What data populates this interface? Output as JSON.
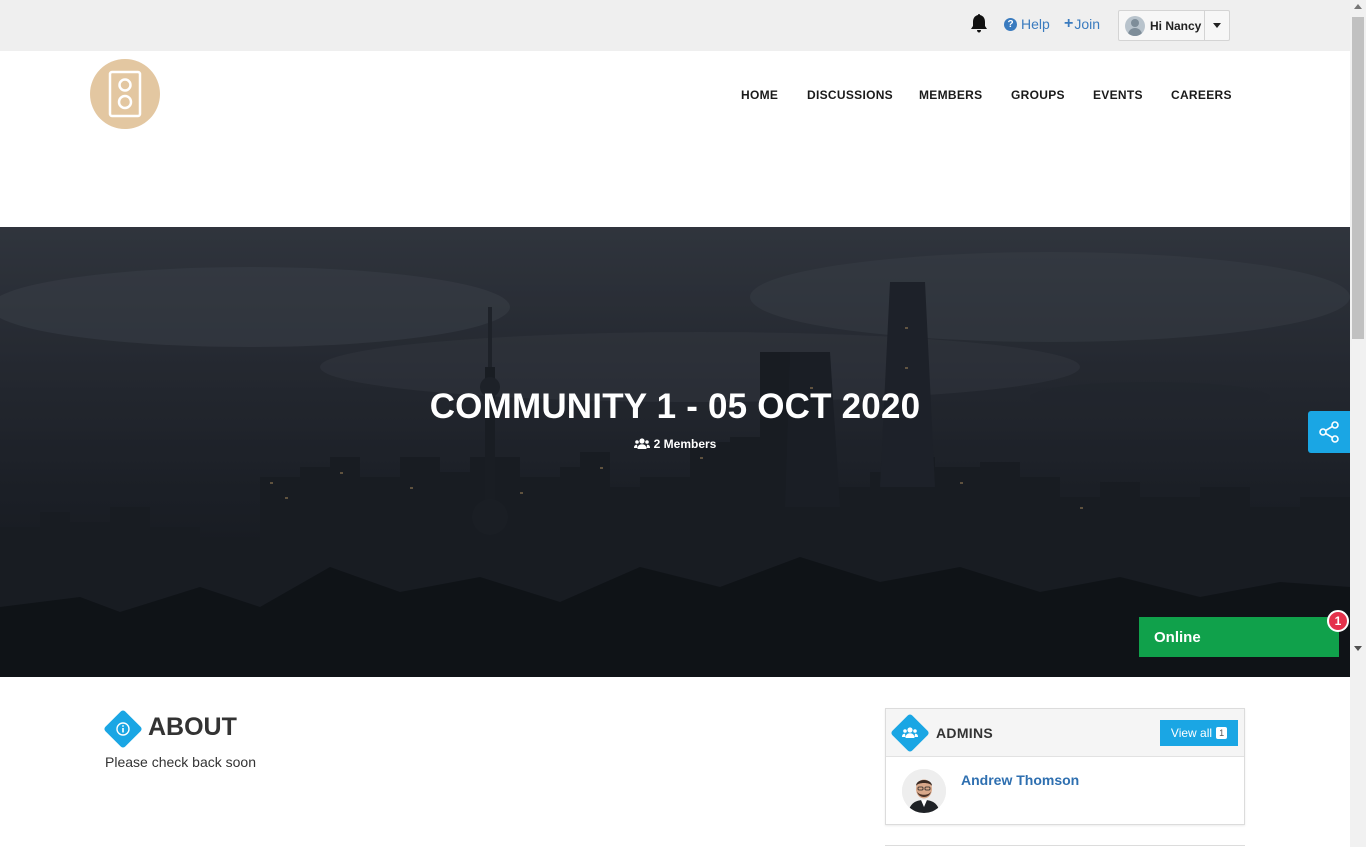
{
  "topbar": {
    "help_label": "Help",
    "join_label": "Join",
    "greeting": "Hi Nancy"
  },
  "nav": {
    "items": [
      "HOME",
      "DISCUSSIONS",
      "MEMBERS",
      "GROUPS",
      "EVENTS",
      "CAREERS"
    ]
  },
  "hero": {
    "title": "COMMUNITY 1 - 05 OCT 2020",
    "members": "2 Members"
  },
  "online": {
    "label": "Online",
    "badge": "1"
  },
  "about": {
    "title": "ABOUT",
    "text": "Please check back soon"
  },
  "admins": {
    "title": "ADMINS",
    "view_all_label": "View all",
    "view_all_count": "1",
    "list": [
      {
        "name": "Andrew Thomson"
      }
    ]
  },
  "colors": {
    "accent": "#1aa6e4",
    "link": "#2e6fb0",
    "online": "#10a14b",
    "badge": "#e4314b",
    "logo_bg": "#e3c7a1"
  },
  "icons": {
    "bell": "bell-icon",
    "help": "question-circle-icon",
    "join": "plus-icon",
    "user": "user-avatar-icon",
    "caret": "caret-down-icon",
    "logo": "speaker-icon",
    "members": "users-icon",
    "share": "share-icon",
    "about": "info-icon",
    "admins": "users-icon"
  }
}
